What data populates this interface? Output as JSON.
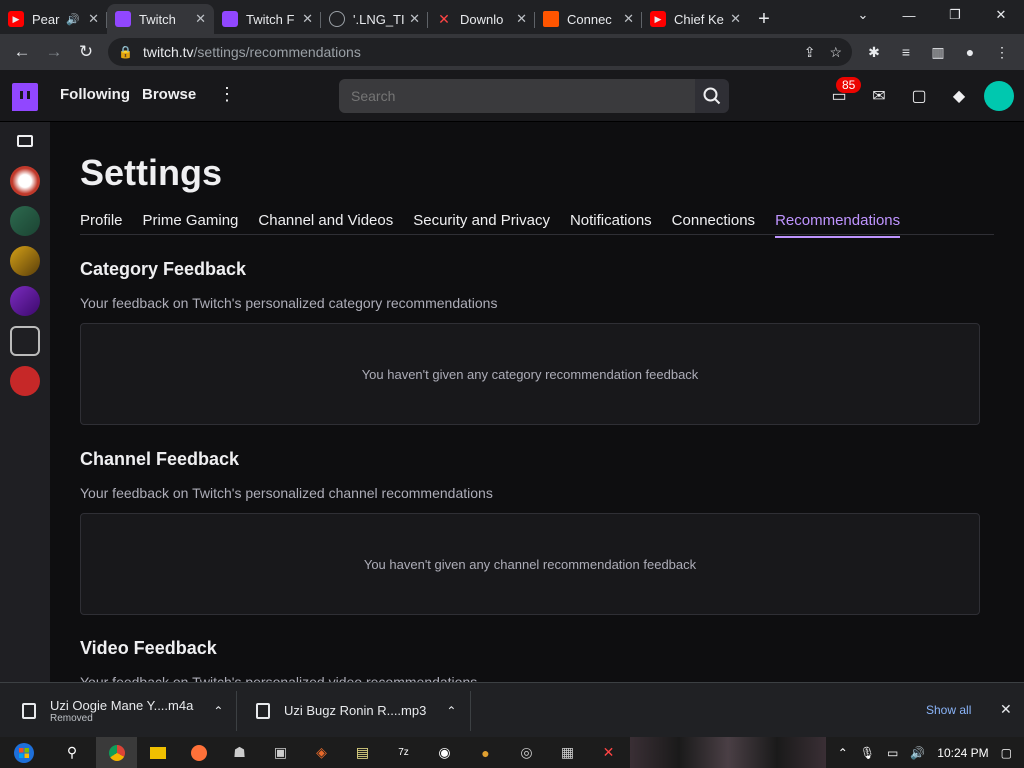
{
  "browser": {
    "tabs": [
      {
        "title": "Pear",
        "favicon_color": "#ff0000",
        "icon": "youtube-icon",
        "active": false
      },
      {
        "title": "Twitch",
        "favicon_color": "#9147ff",
        "icon": "twitch-icon",
        "active": true
      },
      {
        "title": "Twitch F",
        "favicon_color": "#9147ff",
        "icon": "twitch-icon",
        "active": false
      },
      {
        "title": "'.LNG_TI",
        "favicon_color": "#9aa0a6",
        "icon": "globe-icon",
        "active": false
      },
      {
        "title": "Downlo",
        "favicon_color": "#ff4444",
        "icon": "x-logo-icon",
        "active": false
      },
      {
        "title": "Connec",
        "favicon_color": "#ff5500",
        "icon": "square-icon",
        "active": false
      },
      {
        "title": "Chief Ke",
        "favicon_color": "#ff0000",
        "icon": "youtube-icon",
        "active": false
      }
    ],
    "new_tab": "+",
    "url_host": "twitch.tv",
    "url_path": "/settings/recommendations"
  },
  "twitch": {
    "nav": {
      "following": "Following",
      "browse": "Browse"
    },
    "search_placeholder": "Search",
    "notifications_count": "85"
  },
  "settings": {
    "title": "Settings",
    "tabs": [
      "Profile",
      "Prime Gaming",
      "Channel and Videos",
      "Security and Privacy",
      "Notifications",
      "Connections",
      "Recommendations"
    ],
    "active_tab": "Recommendations",
    "sections": [
      {
        "title": "Category Feedback",
        "subtitle": "Your feedback on Twitch's personalized category recommendations",
        "empty": "You haven't given any category recommendation feedback"
      },
      {
        "title": "Channel Feedback",
        "subtitle": "Your feedback on Twitch's personalized channel recommendations",
        "empty": "You haven't given any channel recommendation feedback"
      },
      {
        "title": "Video Feedback",
        "subtitle": "Your feedback on Twitch's personalized video recommendations"
      }
    ]
  },
  "downloads": {
    "items": [
      {
        "name": "Uzi Oogie Mane Y....m4a",
        "status": "Removed"
      },
      {
        "name": "Uzi Bugz Ronin R....mp3",
        "status": ""
      }
    ],
    "show_all": "Show all"
  },
  "taskbar": {
    "time": "10:24 PM"
  }
}
